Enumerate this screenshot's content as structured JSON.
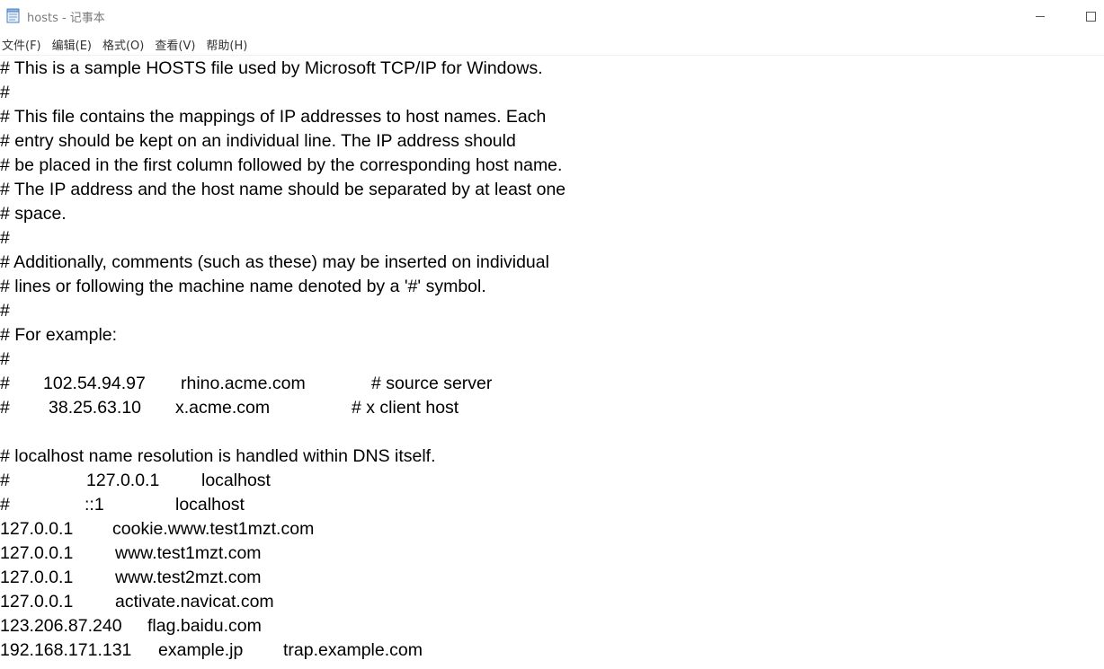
{
  "window": {
    "title": "hosts - 记事本",
    "minimize_glyph": "—",
    "maximize_glyph": "☐"
  },
  "menu": {
    "items": [
      {
        "label": "文件(F)"
      },
      {
        "label": "编辑(E)"
      },
      {
        "label": "格式(O)"
      },
      {
        "label": "查看(V)"
      },
      {
        "label": "帮助(H)"
      }
    ]
  },
  "editor": {
    "lines": [
      "# This is a sample HOSTS file used by Microsoft TCP/IP for Windows.",
      "#",
      "# This file contains the mappings of IP addresses to host names. Each",
      "# entry should be kept on an individual line. The IP address should",
      "# be placed in the first column followed by the corresponding host name.",
      "# The IP address and the host name should be separated by at least one",
      "# space.",
      "#",
      "# Additionally, comments (such as these) may be inserted on individual",
      "# lines or following the machine name denoted by a '#' symbol.",
      "#",
      "# For example:",
      "#"
    ],
    "example_rows": [
      {
        "hash": "#",
        "ip": "102.54.94.97",
        "host": "rhino.acme.com",
        "comment": "# source server"
      },
      {
        "hash": "#",
        "ip": "38.25.63.10",
        "host": "x.acme.com",
        "comment": "# x client host"
      }
    ],
    "localhost_comment": "# localhost name resolution is handled within DNS itself.",
    "localhost_rows": [
      {
        "hash": "#",
        "ip": "127.0.0.1",
        "host": "localhost"
      },
      {
        "hash": "#",
        "ip": "::1",
        "host": "localhost"
      }
    ],
    "entries": [
      {
        "ip": "127.0.0.1",
        "hosts": [
          "cookie.www.test1mzt.com"
        ]
      },
      {
        "ip": "127.0.0.1",
        "hosts": [
          "www.test1mzt.com"
        ]
      },
      {
        "ip": "127.0.0.1",
        "hosts": [
          "www.test2mzt.com"
        ]
      },
      {
        "ip": "127.0.0.1",
        "hosts": [
          "activate.navicat.com"
        ]
      },
      {
        "ip": "123.206.87.240",
        "hosts": [
          "flag.baidu.com"
        ]
      },
      {
        "ip": "192.168.171.131",
        "hosts": [
          "example.jp",
          "trap.example.com"
        ]
      }
    ]
  }
}
